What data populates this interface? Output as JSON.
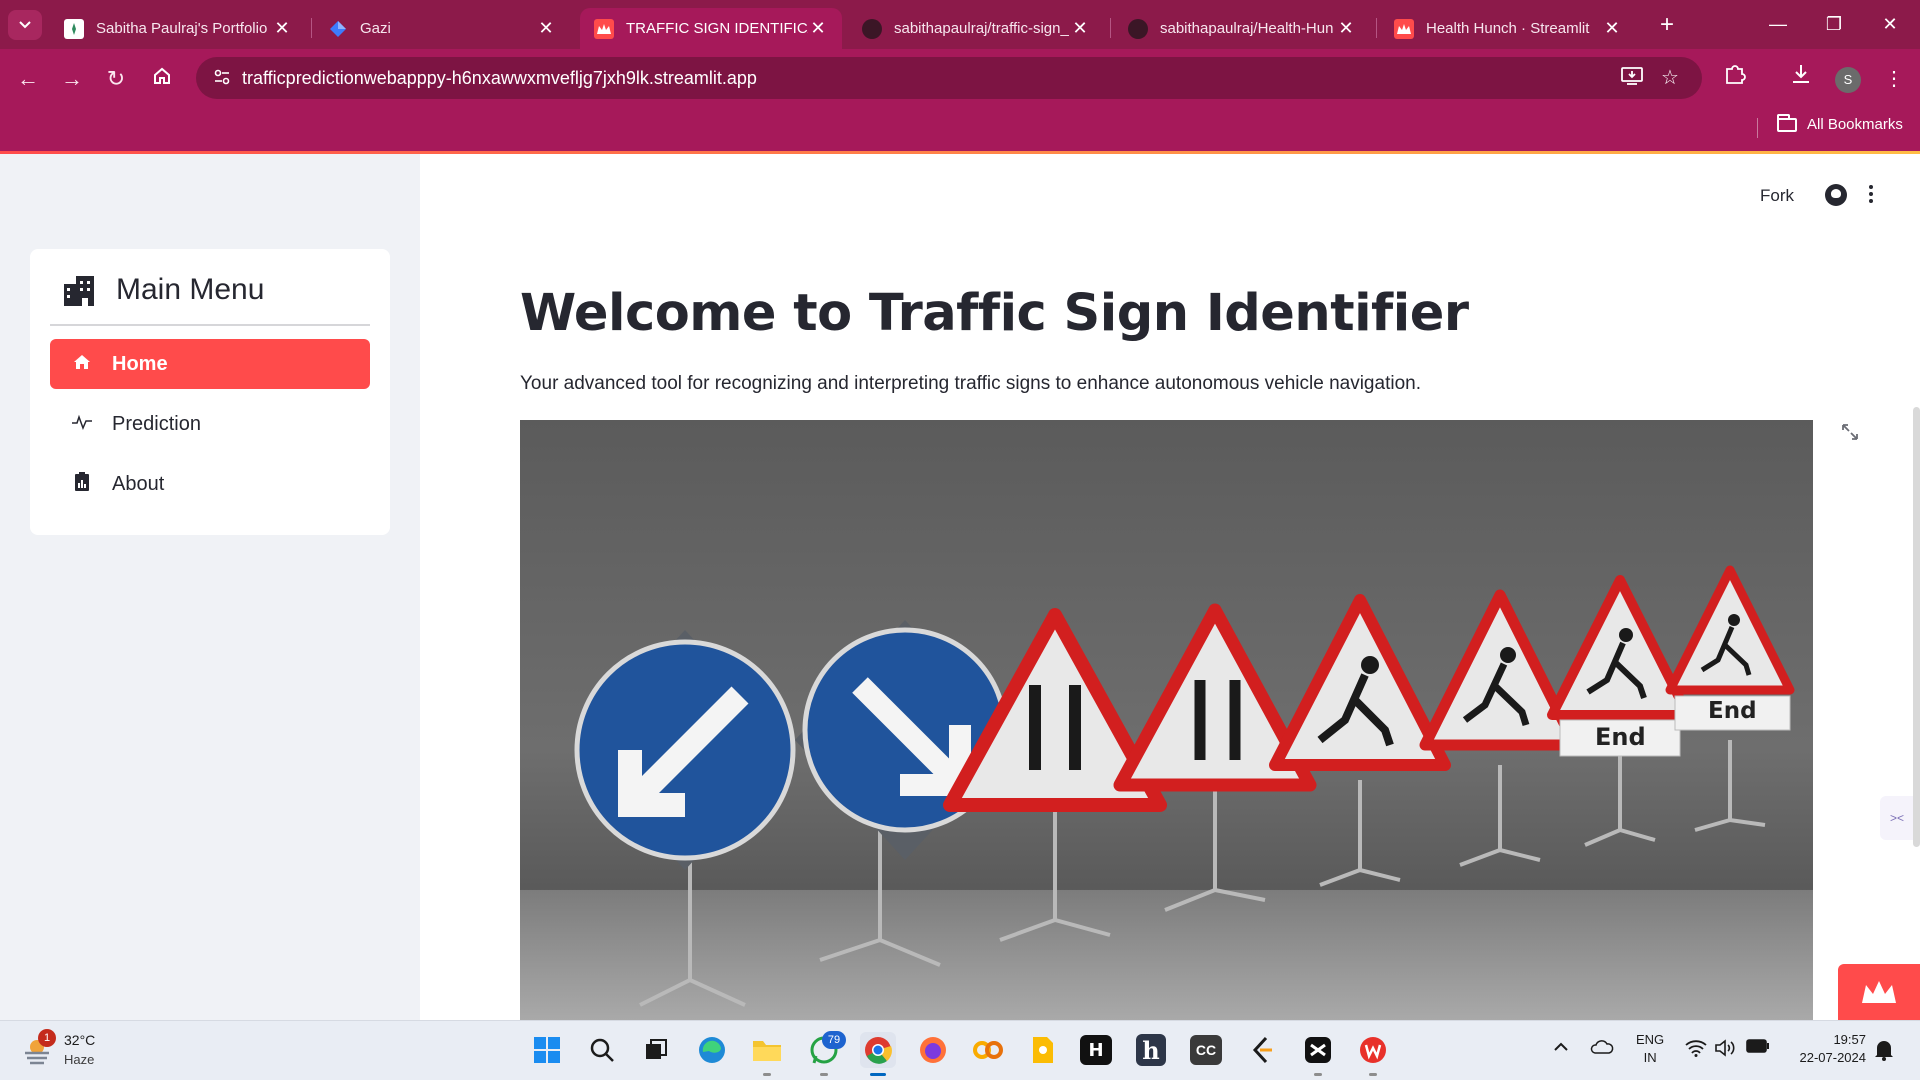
{
  "browser": {
    "tabs": [
      {
        "title": "Sabitha Paulraj's Portfolio",
        "active": false
      },
      {
        "title": "Gazi",
        "active": false
      },
      {
        "title": "TRAFFIC SIGN IDENTIFICAT",
        "active": true
      },
      {
        "title": "sabithapaulraj/traffic-sign_",
        "active": false
      },
      {
        "title": "sabithapaulraj/Health-Hun",
        "active": false
      },
      {
        "title": "Health Hunch · Streamlit",
        "active": false
      }
    ],
    "url": "trafficpredictionwebapppy-h6nxawwxmvefljg7jxh9lk.streamlit.app",
    "profile_initial": "S",
    "bookmarks_label": "All Bookmarks",
    "colors": {
      "frame": "#8c1a4a",
      "toolbar": "#a6195a",
      "omnibox": "#7d1443"
    }
  },
  "app": {
    "header": {
      "fork_label": "Fork"
    },
    "sidebar": {
      "menu_title": "Main Menu",
      "items": [
        {
          "label": "Home",
          "icon": "house-icon",
          "active": true
        },
        {
          "label": "Prediction",
          "icon": "activity-icon",
          "active": false
        },
        {
          "label": "About",
          "icon": "clipboard-data-icon",
          "active": false
        }
      ]
    },
    "main": {
      "title": "Welcome to Traffic Sign Identifier",
      "subtitle": "Your advanced tool for recognizing and interpreting traffic signs to enhance autonomous vehicle navigation.",
      "hero_image": {
        "content": "Row of road signs: two blue keep-left/keep-right arrow signs, two road-narrows triangles, and four roadworks triangles with 'End' plates, against a concrete wall"
      },
      "sign_plates": [
        "End",
        "End"
      ]
    },
    "accent_color": "#ff4b4b"
  },
  "taskbar": {
    "weather": {
      "temp": "32°C",
      "condition": "Haze",
      "badge": "1"
    },
    "whatsapp_badge": "79",
    "pinned_text_icons": [
      "H",
      "h",
      "CC"
    ],
    "language": {
      "line1": "ENG",
      "line2": "IN"
    },
    "clock": {
      "time": "19:57",
      "date": "22-07-2024"
    }
  }
}
